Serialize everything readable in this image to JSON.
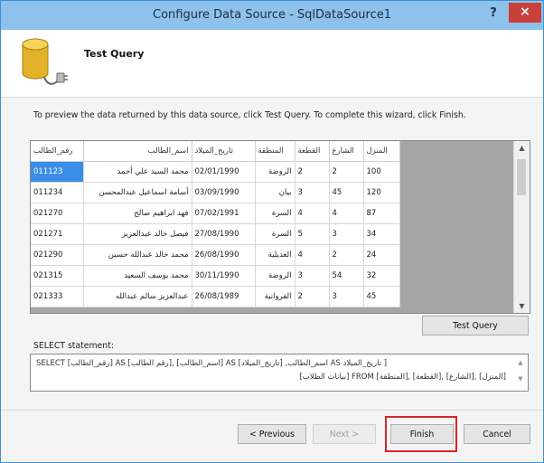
{
  "window": {
    "title": "Configure Data Source - SqlDataSource1",
    "help": "?",
    "close": "×"
  },
  "header": {
    "title": "Test Query"
  },
  "instruction": "To preview the data returned by this data source, click Test Query. To complete this wizard, click Finish.",
  "grid": {
    "columns": [
      "رقم_الطالب",
      "اسم_الطالب",
      "تاريخ_الميلاد",
      "المنطقة",
      "القطعة",
      "الشارع",
      "المنزل"
    ],
    "rows": [
      [
        "011123",
        "محمد السيد علي أحمد",
        "02/01/1990",
        "الروضة",
        "2",
        "2",
        "100"
      ],
      [
        "011234",
        "أسامة اسماعيل عبدالمحسن",
        "03/09/1990",
        "بيان",
        "3",
        "45",
        "120"
      ],
      [
        "021270",
        "فهد ابراهيم صالح",
        "07/02/1991",
        "السرة",
        "4",
        "4",
        "87"
      ],
      [
        "021271",
        "فيصل خالد عبدالعزيز",
        "27/08/1990",
        "السرة",
        "5",
        "3",
        "34"
      ],
      [
        "021290",
        "محمد خالد عبدالله حسين",
        "26/08/1990",
        "العديلية",
        "4",
        "2",
        "24"
      ],
      [
        "021315",
        "محمد يوسف السعيد",
        "30/11/1990",
        "الروضة",
        "3",
        "54",
        "32"
      ],
      [
        "021333",
        "عبدالعزيز سالم عبدالله",
        "26/08/1989",
        "القروانية",
        "2",
        "3",
        "45"
      ]
    ]
  },
  "buttons": {
    "test_query": "Test Query",
    "previous": "< Previous",
    "next": "Next >",
    "finish": "Finish",
    "cancel": "Cancel"
  },
  "sql": {
    "label": "SELECT statement:",
    "line1": "SELECT [رقم_الطالب] AS [رقم الطالب], [اسم_الطالب] AS اسم_الطالب, [تاريخ_الميلاد] AS تاريخ_الميلاد ]",
    "line2": "[المنزل] ,[الشارع] ,[القطعة] ,[المنطقة] FROM [بيانات الطلاب]"
  },
  "colors": {
    "titlebar": "#8ec2ec",
    "close": "#c9403a",
    "selection": "#3a8ee6",
    "highlight": "#d6262b"
  }
}
